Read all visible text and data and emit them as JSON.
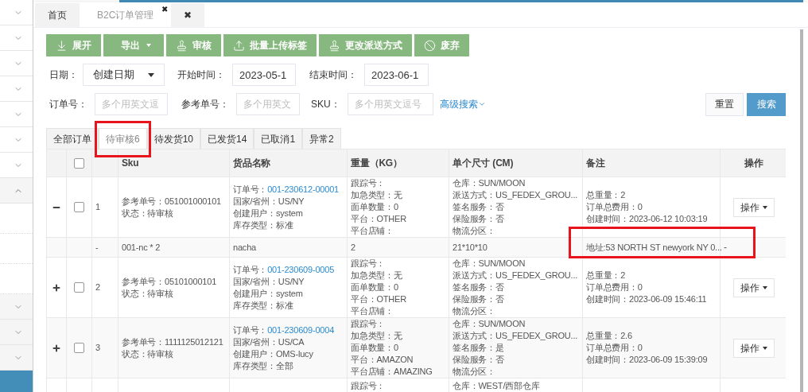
{
  "sidebar": {
    "items": [
      {
        "expanded": false
      },
      {
        "expanded": false
      },
      {
        "expanded": false
      },
      {
        "expanded": false
      },
      {
        "expanded": false
      },
      {
        "expanded": false
      },
      {
        "expanded": false
      },
      {
        "expanded": true,
        "children": [
          {
            "kind": "leaf",
            "selected": false
          },
          {
            "kind": "leaf",
            "selected": false
          },
          {
            "kind": "leaf",
            "selected": false
          },
          {
            "kind": "group",
            "expanded": false
          },
          {
            "kind": "group",
            "expanded": false
          },
          {
            "kind": "group",
            "expanded": false
          },
          {
            "kind": "leaf",
            "selected": true
          }
        ]
      }
    ]
  },
  "page_tabs": [
    {
      "label": "首页",
      "selected": false
    },
    {
      "label": "B2C订单管理",
      "selected": true,
      "close_mark": "✖"
    },
    {
      "label": "✖",
      "selected": false
    }
  ],
  "toolbar": [
    {
      "label": "展开",
      "dropdown": false
    },
    {
      "label": "导出",
      "dropdown": true
    },
    {
      "label": "审核",
      "dropdown": false
    },
    {
      "label": "批量上传标签",
      "dropdown": false
    },
    {
      "label": "更改派送方式",
      "dropdown": false
    },
    {
      "label": "废弃",
      "dropdown": false
    }
  ],
  "filters": {
    "date_label": "日期：",
    "date_select": "创建日期",
    "start_label": "开始时间：",
    "start_value": "2023-05-1",
    "end_label": "结束时间：",
    "end_value": "2023-06-1",
    "order_label": "订单号：",
    "order_placeholder": "多个用英文逗",
    "ref_label": "参考单号：",
    "ref_placeholder": "多个用英文",
    "sku_label": "SKU：",
    "sku_placeholder": "多个用英文逗号",
    "advanced": "高级搜索",
    "reset": "重置",
    "search": "搜索"
  },
  "status_tabs": [
    {
      "label": "全部订单",
      "selected": false,
      "highlighted": false
    },
    {
      "label": "待审核6",
      "selected": true,
      "highlighted": true
    },
    {
      "label": "待发货10",
      "selected": false,
      "highlighted": false
    },
    {
      "label": "已发货14",
      "selected": false,
      "highlighted": false
    },
    {
      "label": "已取消1",
      "selected": false,
      "highlighted": false
    },
    {
      "label": "异常2",
      "selected": false,
      "highlighted": false
    }
  ],
  "table": {
    "select_all_checked": false,
    "columns": [
      "Sku",
      "货品名称",
      "重量（KG）",
      "单个尺寸 (CM)",
      "备注",
      "操作"
    ],
    "rows": [
      {
        "kind": "order",
        "expanded": true,
        "checked": false,
        "index": "1",
        "sku": [
          "参考单号：051001000101",
          "状态：待审核"
        ],
        "order_label": "订单号：",
        "order_no": "001-230612-00001",
        "goods": [
          "国家/省州：US/NY",
          "创建用户：system",
          "库存类型：标准"
        ],
        "weight": [
          "跟踪号：",
          "加急类型：无",
          "面单数量：0",
          "平台：OTHER",
          "平台店铺："
        ],
        "size": [
          "仓库：SUN/MOON",
          "派送方式：US_FEDEX_GROU...",
          "签名服务：否",
          "保险服务：否",
          "物流分区："
        ],
        "remark": [
          "总重量：2",
          "订单总费用：0",
          "创建时间：2023-06-12 10:03:19"
        ],
        "action": "操作"
      },
      {
        "kind": "item",
        "index": "-",
        "sku": "001-nc * 2",
        "goods": "nacha",
        "weight": "2",
        "size": "21*10*10",
        "remark": "地址:53 NORTH ST newyork NY 0...",
        "ops_mark": "-",
        "highlighted": true
      },
      {
        "kind": "order",
        "expanded": false,
        "checked": false,
        "index": "2",
        "sku": [
          "参考单号：05101000101",
          "状态：待审核"
        ],
        "order_label": "订单号：",
        "order_no": "001-230609-0005",
        "goods": [
          "国家/省州：US/NY",
          "创建用户：system",
          "库存类型：标准"
        ],
        "weight": [
          "跟踪号：",
          "加急类型：无",
          "面单数量：0",
          "平台：OTHER",
          "平台店铺："
        ],
        "size": [
          "仓库：SUN/MOON",
          "派送方式：US_FEDEX_GROU...",
          "签名服务：否",
          "保险服务：否",
          "物流分区："
        ],
        "remark": [
          "总重量：2",
          "订单总费用：0",
          "创建时间：2023-06-09 15:46:11"
        ],
        "action": "操作"
      },
      {
        "kind": "order",
        "expanded": false,
        "checked": false,
        "index": "3",
        "sku": [
          "参考单号：1111125012121",
          "状态：待审核"
        ],
        "order_label": "订单号：",
        "order_no": "001-230609-0004",
        "goods": [
          "国家/省州：US/CA",
          "创建用户：OMS-lucy",
          "库存类型：全部"
        ],
        "weight": [
          "跟踪号：",
          "加急类型：无",
          "面单数量：0",
          "平台：AMAZON",
          "平台店铺：AMAZING"
        ],
        "size": [
          "仓库：SUN/MOON",
          "派送方式：US_FEDEX_GROU...",
          "签名服务：是",
          "保险服务：否",
          "物流分区："
        ],
        "remark": [
          "总重量：2.6",
          "订单总费用：0",
          "创建时间：2023-06-09 15:39:09"
        ],
        "action": "操作"
      },
      {
        "kind": "partial",
        "weight": [
          "跟踪号："
        ],
        "size": [
          "仓库：WEST/西部仓库"
        ]
      }
    ]
  }
}
